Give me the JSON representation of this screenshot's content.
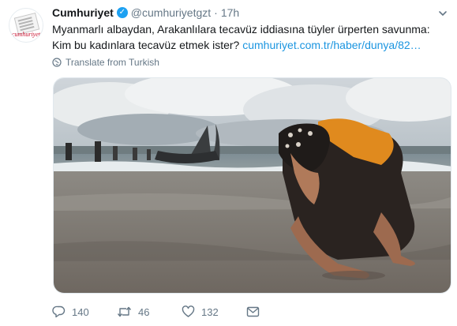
{
  "tweet": {
    "display_name": "Cumhuriyet",
    "handle": "@cumhuriyetgzt",
    "separator": "·",
    "time": "17h",
    "text_line1": "Myanmarlı albaydan, Arakanlılara tecavüz iddiasına tüyler ürperten savunma:",
    "text_line2": "Kim bu kadınlara tecavüz etmek ister?",
    "link_text": "cumhuriyet.com.tr/haber/dunya/82…",
    "translate_label": "Translate from Turkish",
    "avatar_text": "cumhuriyet"
  },
  "actions": {
    "reply_count": "140",
    "retweet_count": "46",
    "like_count": "132"
  },
  "icons": {
    "verified": "verified-badge-icon",
    "caret": "chevron-down-icon",
    "translate": "globe-icon",
    "reply": "reply-icon",
    "retweet": "retweet-icon",
    "like": "heart-icon",
    "dm": "envelope-icon"
  },
  "colors": {
    "link": "#1b95e0",
    "verified": "#1da1f2",
    "muted": "#657786",
    "brand_red": "#c8102e"
  }
}
